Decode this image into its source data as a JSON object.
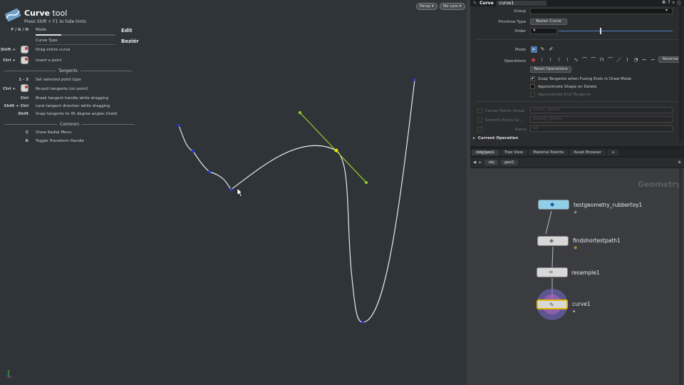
{
  "hud": {
    "title_bold": "Curve",
    "title_rest": "tool",
    "subtitle": "Press Shift + F1 to hide hints",
    "mode_row": {
      "key": "F / G / H",
      "desc": "Mode",
      "value": "Edit"
    },
    "curve_type_row": {
      "desc": "Curve Type",
      "value": "Beziér"
    },
    "rows_top": [
      {
        "key": "Shift +",
        "desc": "Drag entire curve"
      },
      {
        "key": "Ctrl +",
        "desc": "Insert a point"
      }
    ],
    "tangents_heading": "Tangents",
    "tangent_rows": [
      {
        "key": "1 - 3",
        "desc": "Set selected point type"
      },
      {
        "key": "Ctrl +",
        "desc": "Re-pull tangents (on point)"
      },
      {
        "key": "Ctrl",
        "desc": "Break tangent handle while dragging"
      },
      {
        "key": "Shift + Ctrl",
        "desc": "Lock tangent direction while dragging"
      },
      {
        "key": "Shift",
        "desc": "Snap tangents to 45 degree angles (hold)"
      }
    ],
    "common_heading": "Common",
    "common_rows": [
      {
        "key": "C",
        "desc": "Show Radial Menu"
      },
      {
        "key": "K",
        "desc": "Toggle Transform Handle"
      }
    ]
  },
  "viewport": {
    "persp_label": "Persp ▾",
    "cam_label": "No cam ▾",
    "axis_label": "y\nz",
    "icons": {
      "tool": "curve-tool-icon",
      "mouse": "mouse-icon",
      "cursor": "cursor-arrow-icon"
    }
  },
  "params": {
    "node_type": "Curve",
    "node_name": "curve1",
    "group_label": "Group",
    "group_value": "",
    "primitive_type_label": "Primitive Type",
    "primitive_type_value": "Bezier Curve",
    "order_label": "Order",
    "order_value": "4",
    "mode_label": "Mode",
    "operations_label": "Operations",
    "reverse_label": "Reverse",
    "reset_ops_label": "Reset Operations",
    "checks": [
      {
        "label": "Snap Tangents when Fusing Ends in Draw Mode",
        "checked": true,
        "dim": false
      },
      {
        "label": "Approximate Shape on Delete",
        "checked": false,
        "dim": false
      },
      {
        "label": "Approximate End Tangents",
        "checked": false,
        "dim": true
      }
    ],
    "dim_rows": [
      {
        "label": "Corner Points Group",
        "value": "corner_points"
      },
      {
        "label": "Smooth Points Gr...",
        "value": "smooth_points"
      },
      {
        "label": "Name",
        "value": "sel"
      }
    ],
    "current_operation_label": "Current Operation"
  },
  "network": {
    "tabs": [
      "/obj/geo1",
      "Tree View",
      "Material Palette",
      "Asset Browser",
      "+"
    ],
    "path": [
      "obj",
      "geo1"
    ],
    "context_label": "Geometry",
    "nodes": [
      {
        "name": "testgeometry_rubbertoy1",
        "glyph": "◆",
        "color": "#8fd0e8"
      },
      {
        "name": "findshortestpath1",
        "glyph": "◈",
        "color": "#d8d8d8"
      },
      {
        "name": "resample1",
        "glyph": "≈",
        "color": "#d8d8d8"
      },
      {
        "name": "curve1",
        "glyph": "✎",
        "color": "#d8d8d8"
      }
    ]
  },
  "colors": {
    "viewport_bg": "#2e3438",
    "curve": "#e8e8e8",
    "handle": "#9ad02a",
    "point": "#2a3bd6",
    "selected_point": "#e6e600"
  }
}
